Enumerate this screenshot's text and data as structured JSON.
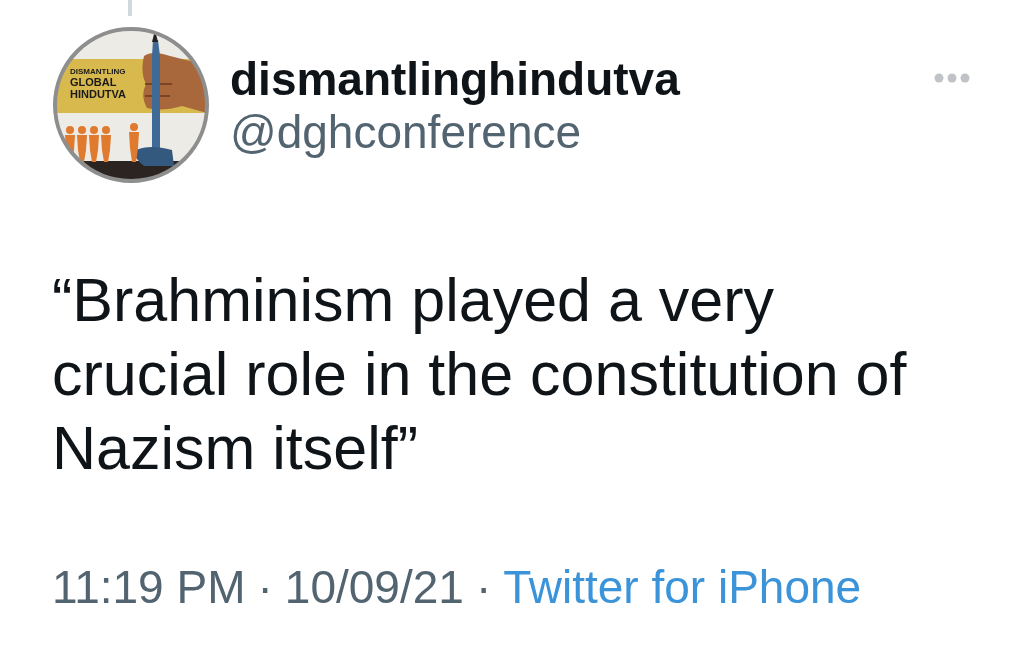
{
  "tweet": {
    "author": {
      "name": "dismantlinghindutva",
      "handle": "@dghconference",
      "avatar_text": [
        "DISMANTLING",
        "GLOBAL",
        "HINDUTVA"
      ]
    },
    "text": "“Brahminism played a very crucial role in the constitution of Nazism itself”",
    "meta": [
      {
        "kind": "time",
        "text": "11:19 PM"
      },
      {
        "kind": "separator",
        "text": "·"
      },
      {
        "kind": "date",
        "text": "10/09/21"
      },
      {
        "kind": "separator",
        "text": "·"
      },
      {
        "kind": "source",
        "text": "Twitter for iPhone"
      }
    ]
  }
}
